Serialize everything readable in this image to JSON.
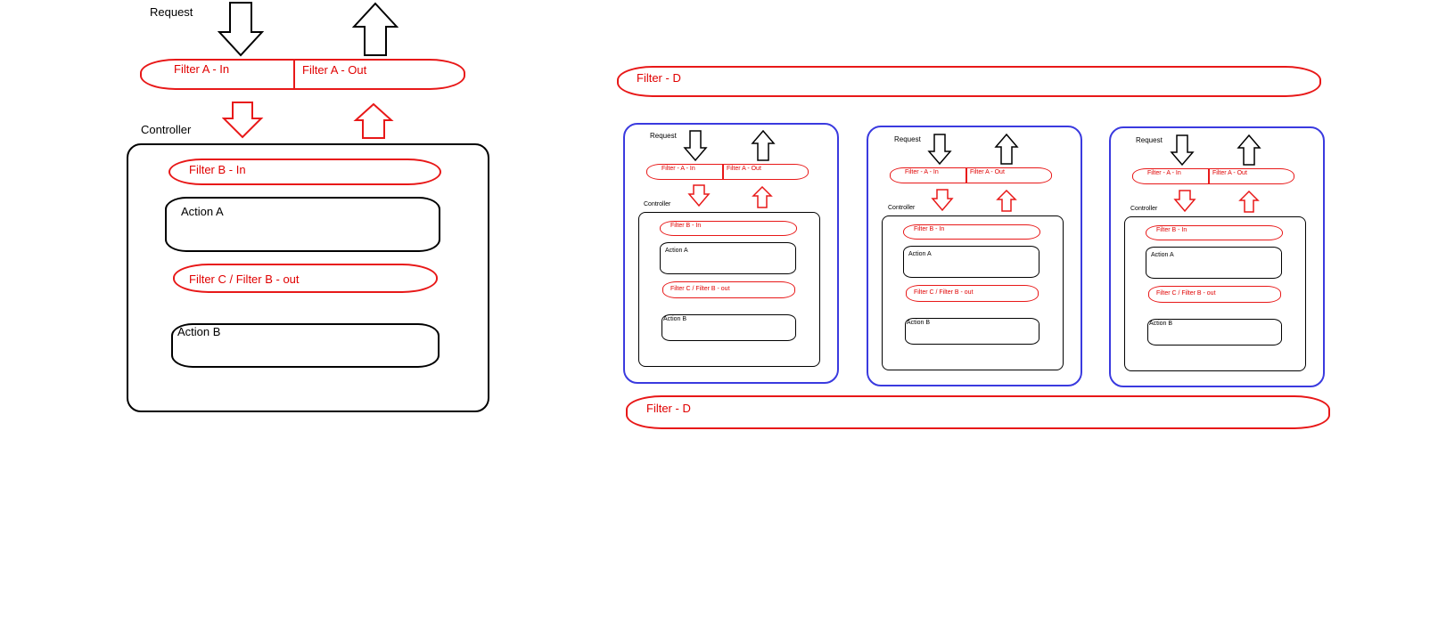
{
  "main": {
    "request": "Request",
    "filter_a_in": "Filter  A - In",
    "filter_a_out": "Filter A - Out",
    "controller": "Controller",
    "filter_b_in": "Filter B   - In",
    "action_a": "Action A",
    "filter_c_b_out": "Filter   C      / Filter B - out",
    "action_b": "Action B"
  },
  "filter_d_top": "Filter - D",
  "filter_d_bottom": "Filter - D",
  "mini": {
    "request": "Request",
    "filter_a_in": "Filter - A - In",
    "filter_a_out": "Filter A - Out",
    "controller": "Controller",
    "filter_b_in": "Filter B - In",
    "action_a": "Action A",
    "filter_c": "Filter  C   / Filter B - out",
    "action_b": "Action B"
  },
  "colors": {
    "red": "#e81818",
    "blue": "#3a3adf",
    "black": "#000000"
  }
}
